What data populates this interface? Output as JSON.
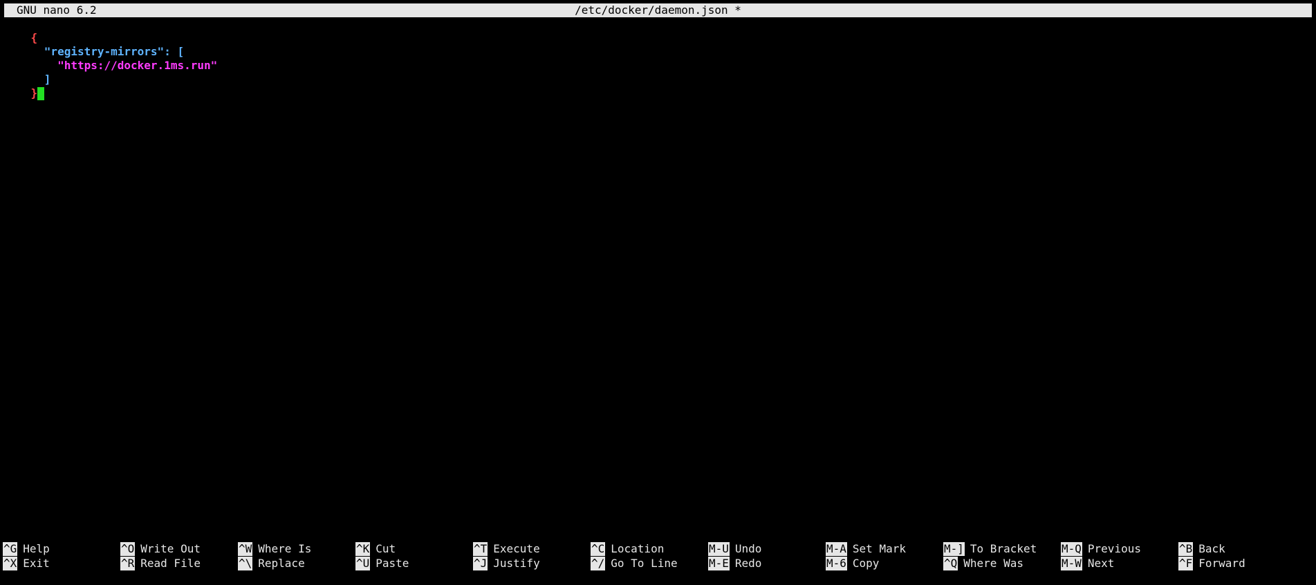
{
  "titlebar": {
    "version": "GNU nano 6.2",
    "filename": "/etc/docker/daemon.json *"
  },
  "editor": {
    "line1": "{",
    "line2_key": "\"registry-mirrors\"",
    "line2_colon": ":",
    "line2_bracket": "[",
    "line3_value": "\"https://docker.1ms.run\"",
    "line4_bracket": "]",
    "line5_brace": "}"
  },
  "shortcuts": {
    "top": [
      {
        "key": "^G",
        "label": "Help"
      },
      {
        "key": "^O",
        "label": "Write Out"
      },
      {
        "key": "^W",
        "label": "Where Is"
      },
      {
        "key": "^K",
        "label": "Cut"
      },
      {
        "key": "^T",
        "label": "Execute"
      },
      {
        "key": "^C",
        "label": "Location"
      },
      {
        "key": "M-U",
        "label": "Undo"
      },
      {
        "key": "M-A",
        "label": "Set Mark"
      },
      {
        "key": "M-]",
        "label": "To Bracket"
      },
      {
        "key": "M-Q",
        "label": "Previous"
      },
      {
        "key": "^B",
        "label": "Back"
      }
    ],
    "bottom": [
      {
        "key": "^X",
        "label": "Exit"
      },
      {
        "key": "^R",
        "label": "Read File"
      },
      {
        "key": "^\\",
        "label": "Replace"
      },
      {
        "key": "^U",
        "label": "Paste"
      },
      {
        "key": "^J",
        "label": "Justify"
      },
      {
        "key": "^/",
        "label": "Go To Line"
      },
      {
        "key": "M-E",
        "label": "Redo"
      },
      {
        "key": "M-6",
        "label": "Copy"
      },
      {
        "key": "^Q",
        "label": "Where Was"
      },
      {
        "key": "M-W",
        "label": "Next"
      },
      {
        "key": "^F",
        "label": "Forward"
      }
    ]
  },
  "colors": {
    "background": "#000000",
    "titlebar_bg": "#e6e6e6",
    "brace": "#ff4a4a",
    "key": "#5fb4ff",
    "string": "#ff3cff",
    "cursor": "#22e022"
  }
}
